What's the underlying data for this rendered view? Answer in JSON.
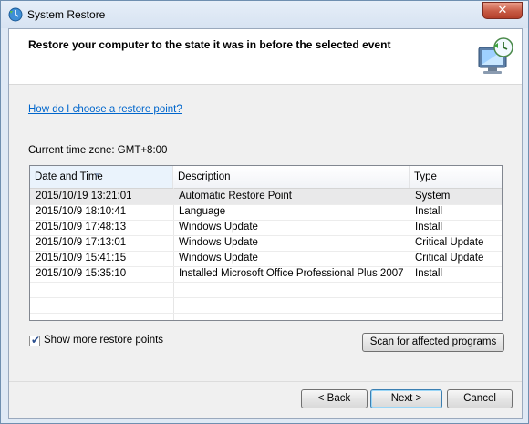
{
  "window": {
    "title": "System Restore",
    "close_label": "✕"
  },
  "header": {
    "title": "Restore your computer to the state it was in before the selected event"
  },
  "help_link": "How do I choose a restore point?",
  "timezone": "Current time zone: GMT+8:00",
  "table": {
    "columns": [
      "Date and Time",
      "Description",
      "Type"
    ],
    "rows": [
      {
        "date": "2015/10/19 13:21:01",
        "description": "Automatic Restore Point",
        "type": "System",
        "selected": true
      },
      {
        "date": "2015/10/9 18:10:41",
        "description": "Language",
        "type": "Install"
      },
      {
        "date": "2015/10/9 17:48:13",
        "description": "Windows Update",
        "type": "Install"
      },
      {
        "date": "2015/10/9 17:13:01",
        "description": "Windows Update",
        "type": "Critical Update"
      },
      {
        "date": "2015/10/9 15:41:15",
        "description": "Windows Update",
        "type": "Critical Update"
      },
      {
        "date": "2015/10/9 15:35:10",
        "description": "Installed Microsoft Office Professional Plus 2007",
        "type": "Install"
      }
    ]
  },
  "show_more": {
    "label": "Show more restore points",
    "checked": true
  },
  "buttons": {
    "scan": "Scan for affected programs",
    "back": "< Back",
    "next": "Next >",
    "cancel": "Cancel"
  }
}
